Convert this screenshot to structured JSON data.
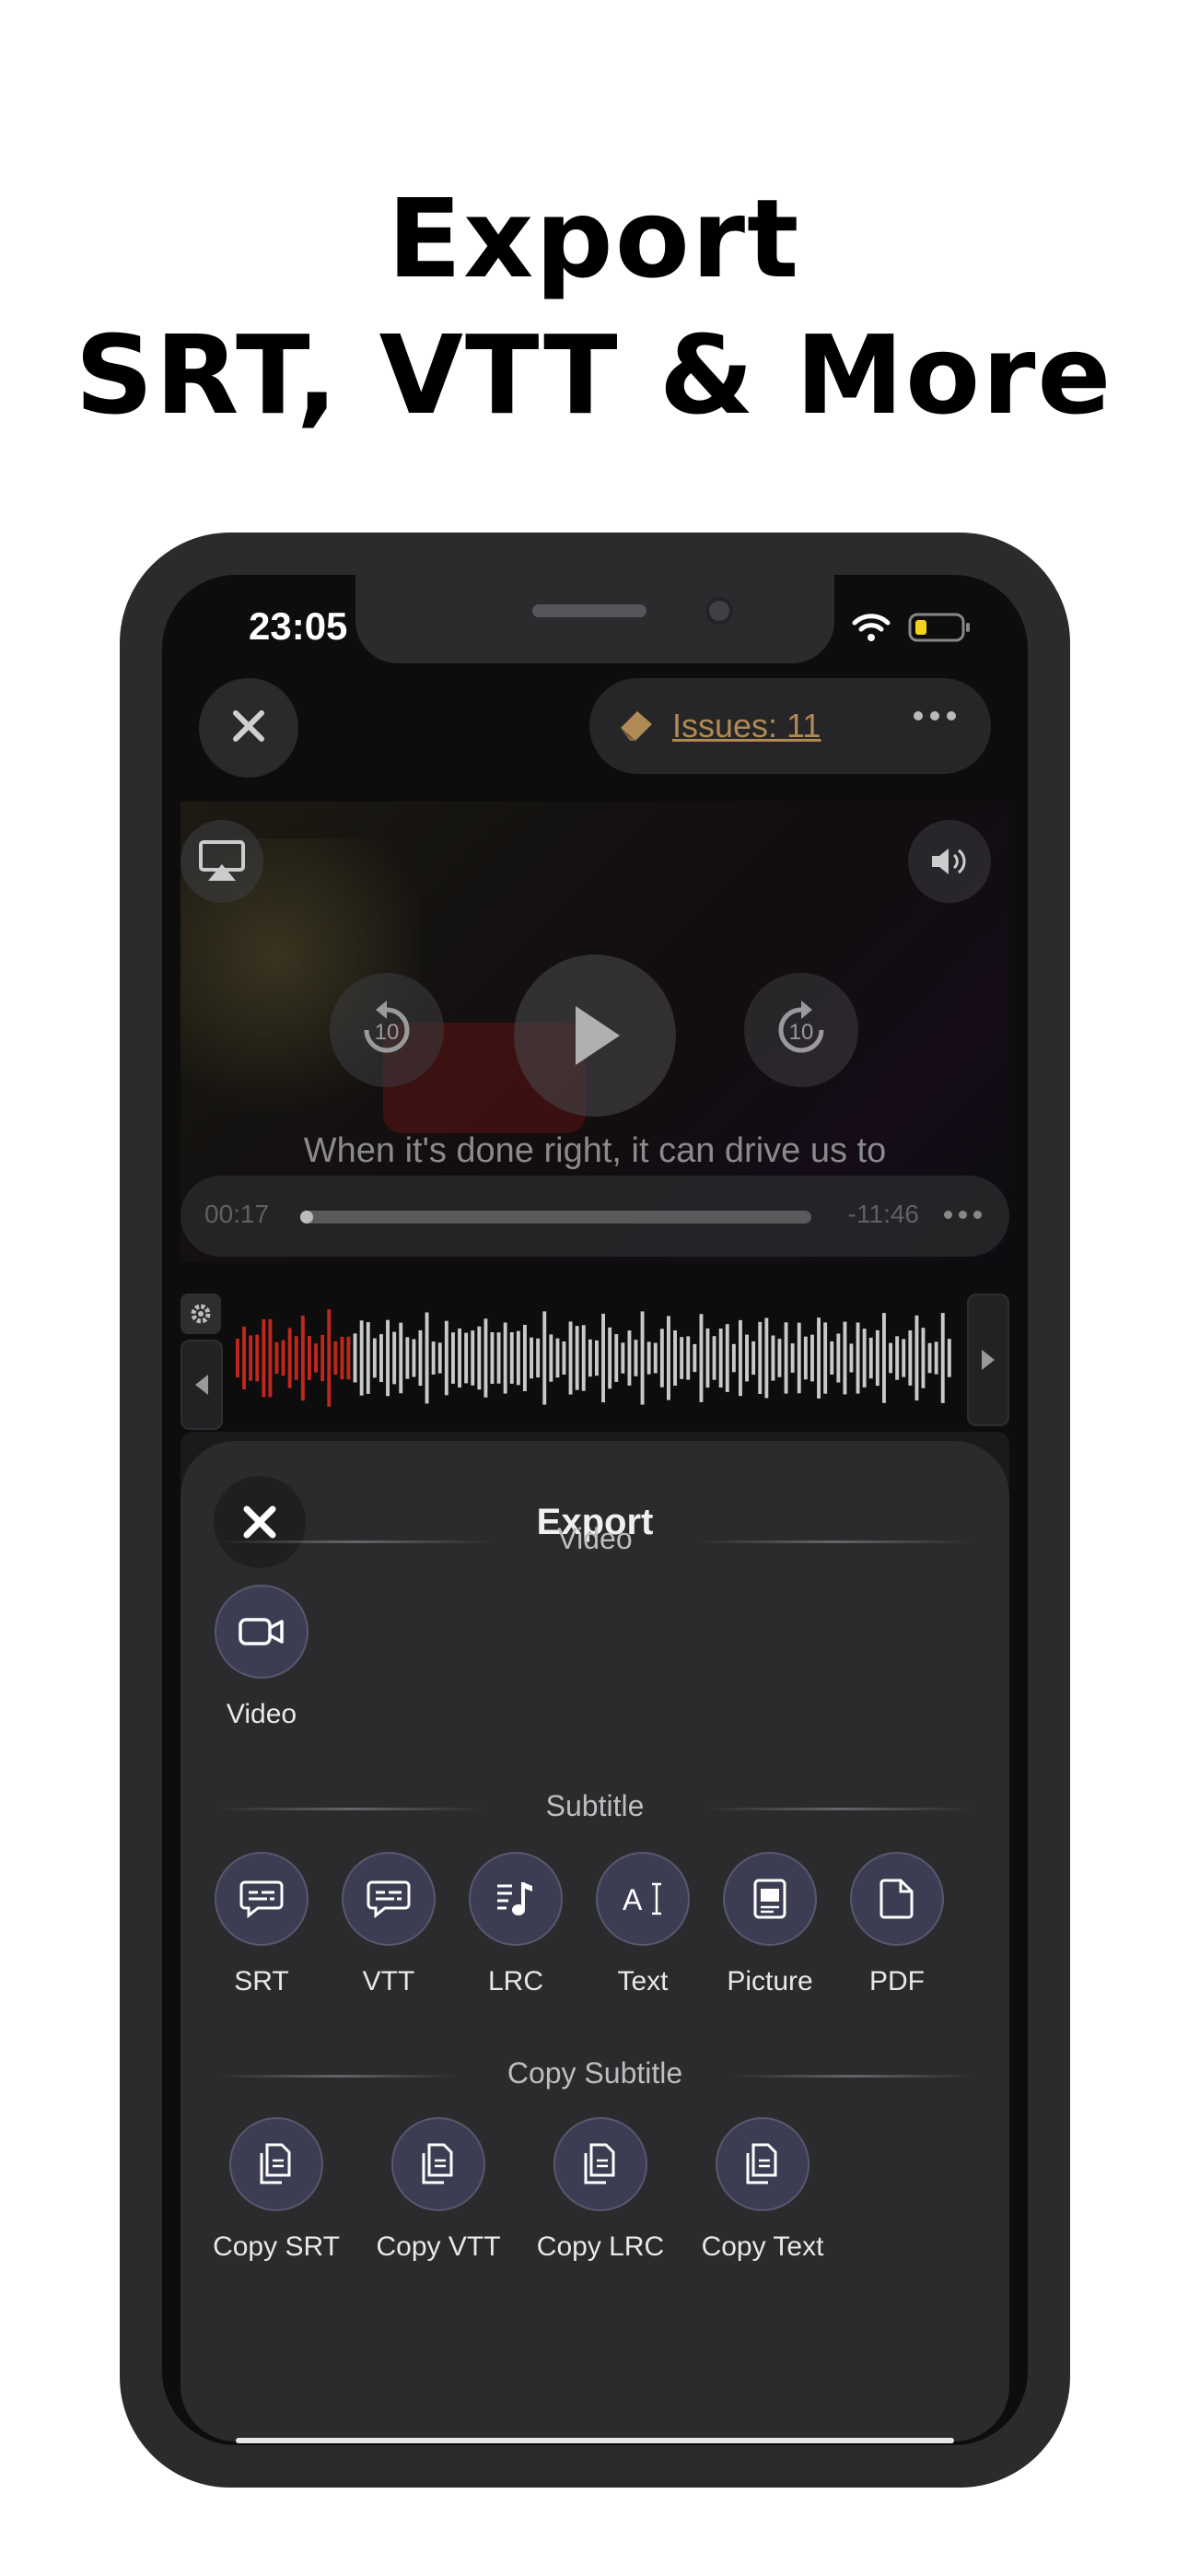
{
  "promo": {
    "headline_line1": "Export",
    "headline_line2": "SRT, VTT & More"
  },
  "status_bar": {
    "time": "23:05",
    "icons": [
      "wifi-icon",
      "battery-low-icon"
    ]
  },
  "top_bar": {
    "close_icon": "close-icon",
    "issues_label": "Issues: 11",
    "issues_icon": "eraser-icon",
    "more_icon": "more-dots-icon",
    "issues_color": "#b08a55"
  },
  "player": {
    "subtitle_text": "When it's done right, it can drive us to",
    "current_time": "00:17",
    "remaining_time": "-11:46",
    "progress": 0.02,
    "skip_back_seconds": "10",
    "skip_forward_seconds": "10"
  },
  "waveform": {
    "played_color": "#c0271d",
    "unplayed_color": "#c9c9cb",
    "played_fraction": 0.16
  },
  "export_sheet": {
    "title": "Export",
    "sections": {
      "video": {
        "label": "Video",
        "items": [
          {
            "label": "Video",
            "icon": "video-camera-icon"
          }
        ]
      },
      "subtitle": {
        "label": "Subtitle",
        "items": [
          {
            "label": "SRT",
            "icon": "subtitle-bubble-icon"
          },
          {
            "label": "VTT",
            "icon": "subtitle-bubble-icon"
          },
          {
            "label": "LRC",
            "icon": "lyrics-icon"
          },
          {
            "label": "Text",
            "icon": "text-cursor-icon"
          },
          {
            "label": "Picture",
            "icon": "picture-document-icon"
          },
          {
            "label": "PDF",
            "icon": "document-icon"
          }
        ]
      },
      "copy_subtitle": {
        "label": "Copy Subtitle",
        "items": [
          {
            "label": "Copy SRT",
            "icon": "copy-document-icon"
          },
          {
            "label": "Copy VTT",
            "icon": "copy-document-icon"
          },
          {
            "label": "Copy LRC",
            "icon": "copy-document-icon"
          },
          {
            "label": "Copy Text",
            "icon": "copy-document-icon"
          }
        ]
      }
    },
    "accent_color": "#3c3d52"
  }
}
